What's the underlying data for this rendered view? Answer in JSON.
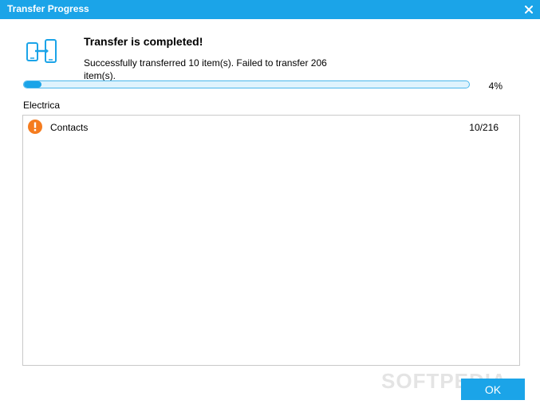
{
  "window": {
    "title": "Transfer Progress",
    "close_label": "X"
  },
  "status": {
    "icon": "phone-transfer-icon",
    "headline": "Transfer is completed!",
    "detail": "Successfully transferred 10 item(s). Failed to transfer 206 item(s).",
    "progress_fraction": 0.04,
    "progress_text": "4%"
  },
  "section": {
    "label": "Electrica"
  },
  "items": [
    {
      "icon": "warning-icon",
      "name": "Contacts",
      "count": "10/216"
    }
  ],
  "footer": {
    "watermark": "SOFTPEDIA",
    "ok_label": "OK"
  },
  "colors": {
    "accent": "#1ba4e8",
    "warning": "#f57c1f",
    "border": "#c9c9c9"
  }
}
